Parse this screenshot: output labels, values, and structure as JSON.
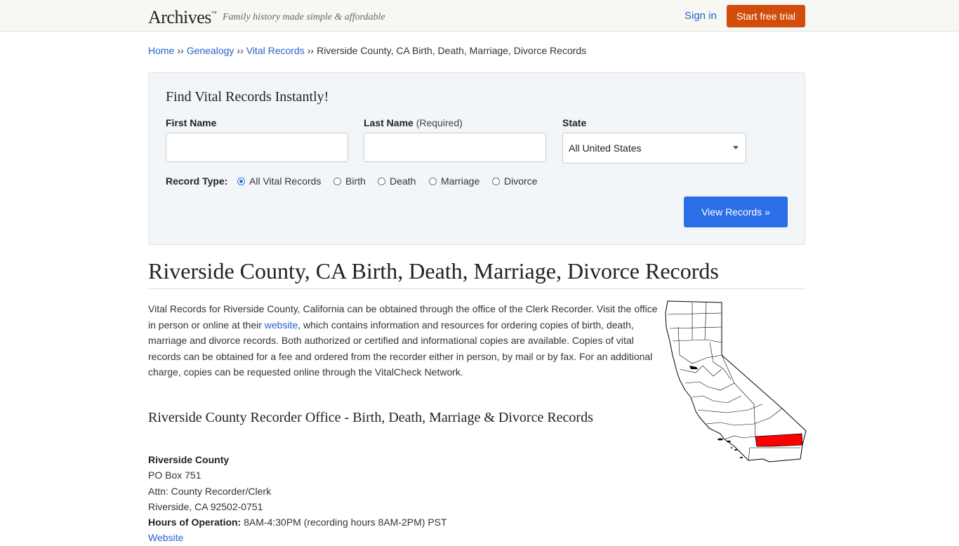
{
  "header": {
    "logo": "Archives",
    "logo_tm": "™",
    "tagline": "Family history made simple & affordable",
    "signin": "Sign in",
    "trial": "Start free trial"
  },
  "breadcrumb": {
    "items": [
      "Home",
      "Genealogy",
      "Vital Records"
    ],
    "separator": "››",
    "current": "Riverside County, CA Birth, Death, Marriage, Divorce Records"
  },
  "search": {
    "title": "Find Vital Records Instantly!",
    "first_name_label": "First Name",
    "last_name_label": "Last Name",
    "last_name_req": "(Required)",
    "state_label": "State",
    "state_value": "All United States",
    "first_name_value": "",
    "last_name_value": "",
    "record_type_label": "Record Type:",
    "record_types": [
      "All Vital Records",
      "Birth",
      "Death",
      "Marriage",
      "Divorce"
    ],
    "selected_record_type": "All Vital Records",
    "submit": "View Records »"
  },
  "main": {
    "title": "Riverside County, CA Birth, Death, Marriage, Divorce Records",
    "intro_before": "Vital Records for Riverside County, California can be obtained through the office of the Clerk Recorder. Visit the office in person or online at their ",
    "intro_link": "website",
    "intro_after": ", which contains information and resources for ordering copies of birth, death, marriage and divorce records. Both authorized or certified and informational copies are available. Copies of vital records can be obtained for a fee and ordered from the recorder either in person, by mail or by fax. For an additional charge, copies can be requested online through the VitalCheck Network.",
    "section_title": "Riverside County Recorder Office - Birth, Death, Marriage & Divorce Records"
  },
  "office": {
    "name": "Riverside County",
    "address1": "PO Box 751",
    "address2": "Attn: County Recorder/Clerk",
    "address3": "Riverside, CA 92502-0751",
    "hours_label": "Hours of Operation:",
    "hours": "8AM-4:30PM (recording hours 8AM-2PM) PST",
    "website": "Website"
  },
  "colors": {
    "accent_orange": "#d24d0b",
    "primary_blue": "#2a6fe8",
    "link": "#2563c9",
    "highlight_county": "#ff0000"
  }
}
